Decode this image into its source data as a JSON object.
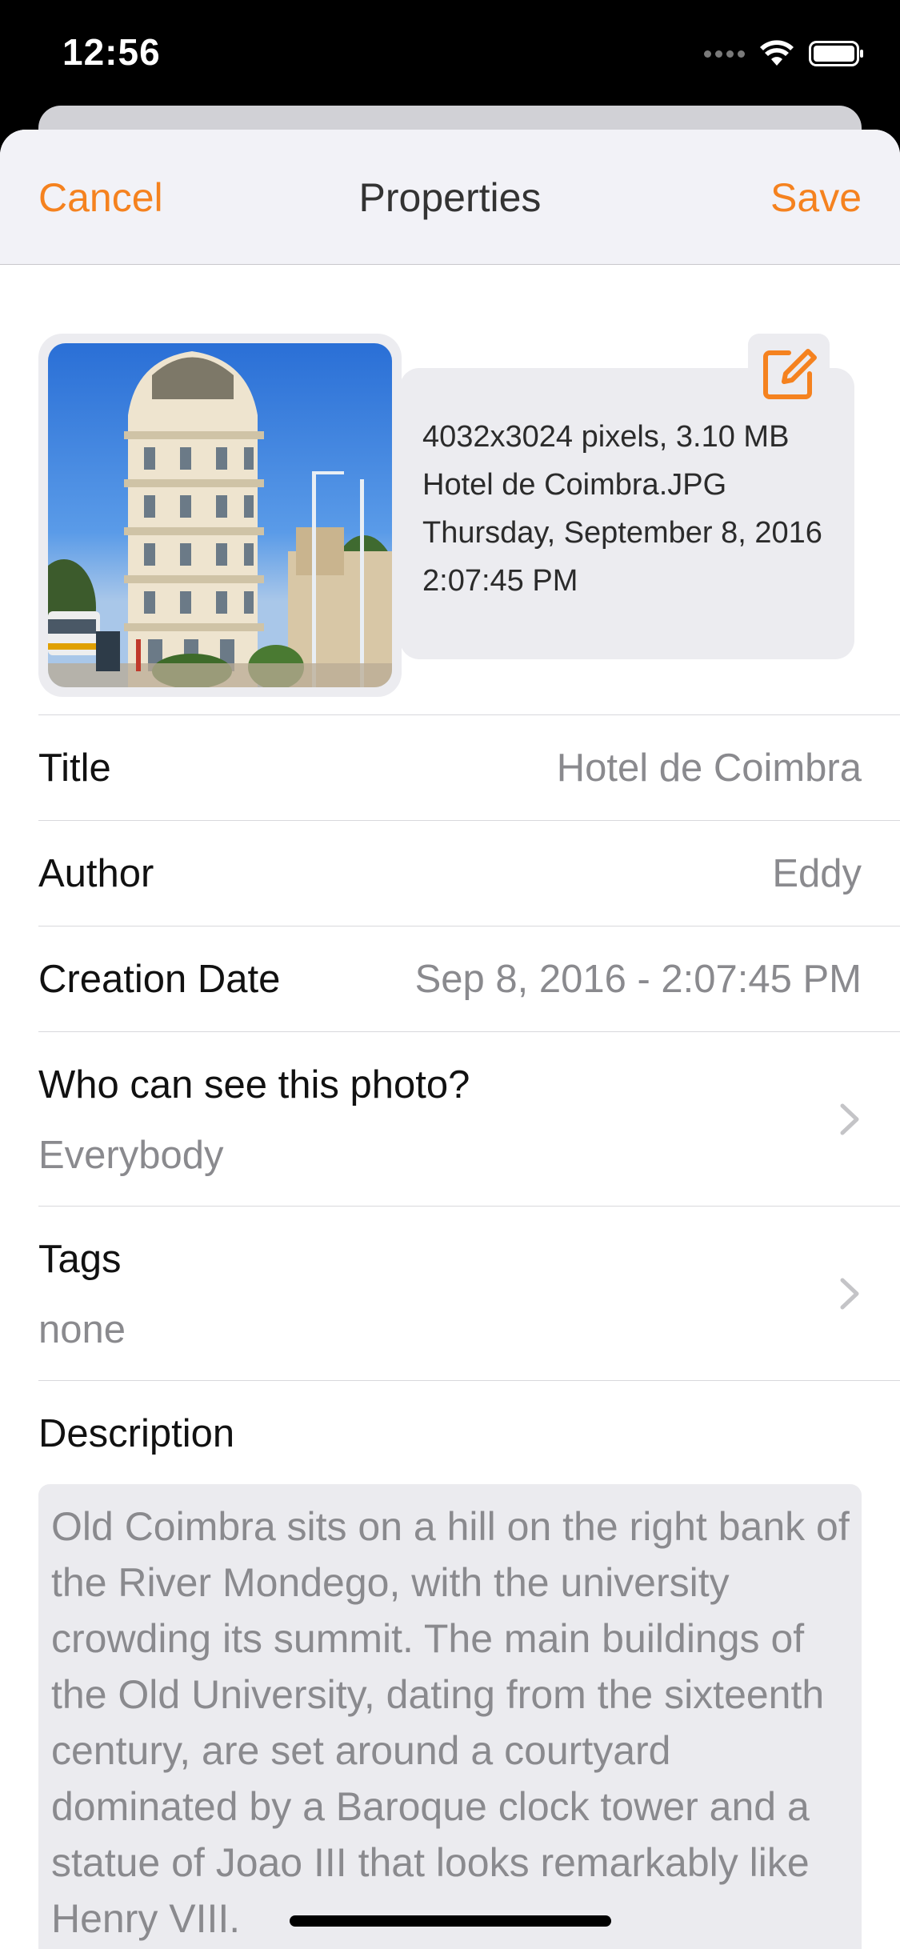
{
  "status_bar": {
    "time": "12:56"
  },
  "nav": {
    "cancel_label": "Cancel",
    "title": "Properties",
    "save_label": "Save",
    "accent_color": "#f5821f"
  },
  "photo": {
    "dimensions_size": "4032x3024 pixels, 3.10 MB",
    "filename": "Hotel de Coimbra.JPG",
    "date": "Thursday, September 8, 2016",
    "time": "2:07:45 PM",
    "edit_icon": "edit-square-pencil-icon"
  },
  "fields": {
    "title": {
      "label": "Title",
      "value": "Hotel de Coimbra"
    },
    "author": {
      "label": "Author",
      "value": "Eddy"
    },
    "creation_date": {
      "label": "Creation Date",
      "value": "Sep 8, 2016 - 2:07:45 PM"
    },
    "visibility": {
      "label": "Who can see this photo?",
      "value": "Everybody"
    },
    "tags": {
      "label": "Tags",
      "value": "none"
    },
    "description": {
      "label": "Description",
      "value": "Old Coimbra sits on a hill on the right bank of the River Mondego, with the university crowding its summit. The main buildings of the Old University, dating from the sixteenth century, are set around a courtyard dominated by a Baroque clock tower and a statue of Joao III that looks remarkably like Henry VIII."
    }
  }
}
